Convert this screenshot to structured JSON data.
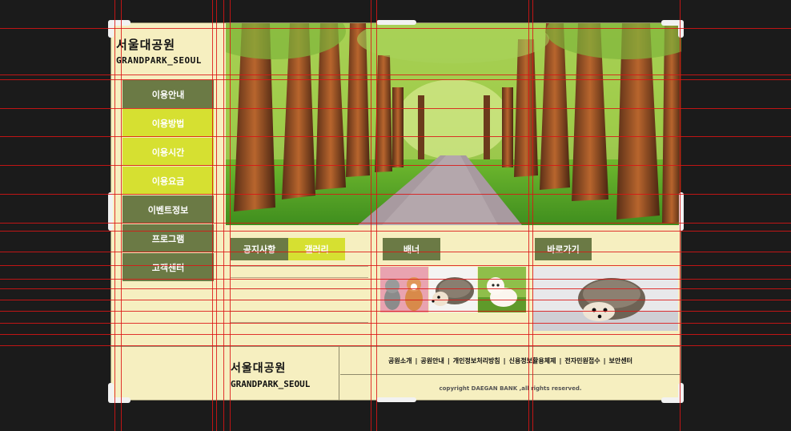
{
  "brand": {
    "name_ko": "서울대공원",
    "name_en": "GRANDPARK_SEOUL"
  },
  "menu": [
    {
      "label": "이용안내",
      "style": "dark"
    },
    {
      "label": "이용방법",
      "style": "lime"
    },
    {
      "label": "이용시간",
      "style": "lime"
    },
    {
      "label": "이용요금",
      "style": "lime"
    },
    {
      "label": "이벤트정보",
      "style": "dark"
    },
    {
      "label": "프로그램",
      "style": "dark"
    },
    {
      "label": "고객센터",
      "style": "dark"
    }
  ],
  "tabs": {
    "notice": "공지사항",
    "gallery": "갤러리"
  },
  "banner": {
    "title": "배너"
  },
  "quick": {
    "title": "바로가기"
  },
  "footer": {
    "links": [
      "공원소개",
      "공원안내",
      "개인정보처리방침",
      "신용정보활용체제",
      "전자민원접수",
      "보안센터"
    ],
    "copyright": "copyright DAEGAN BANK ,all rights reserved."
  },
  "colors": {
    "panel": "#f6efc0",
    "menu_dark": "#6b7a45",
    "menu_lime": "#d6e031",
    "guide": "#dc1414"
  }
}
